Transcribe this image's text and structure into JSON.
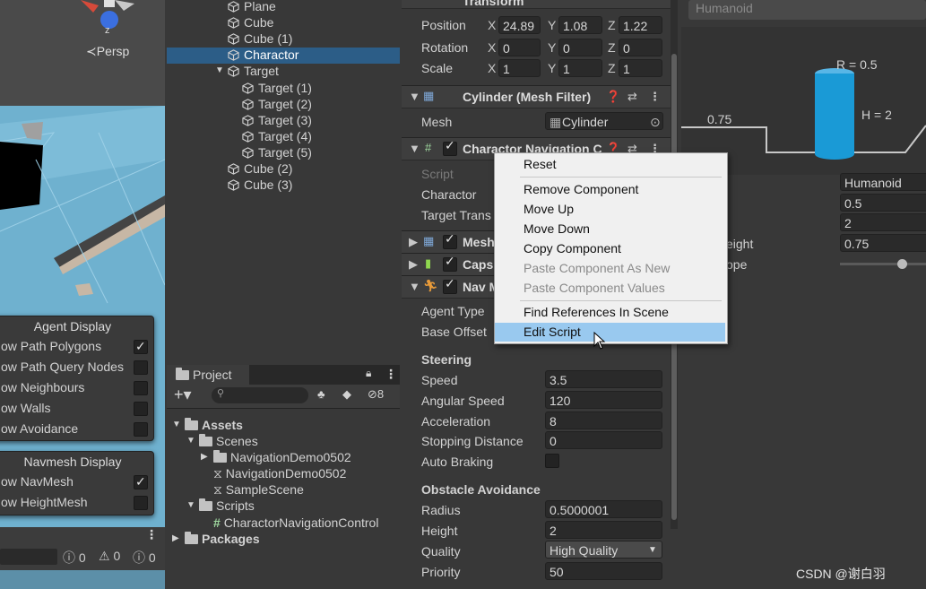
{
  "scene": {
    "axis_label": "z",
    "persp_label": "≺Persp",
    "agent_display": {
      "title": "Agent Display",
      "items": [
        {
          "label": "ow Path Polygons",
          "checked": true
        },
        {
          "label": "ow Path Query Nodes",
          "checked": false
        },
        {
          "label": "ow Neighbours",
          "checked": false
        },
        {
          "label": "ow Walls",
          "checked": false
        },
        {
          "label": "ow Avoidance",
          "checked": false
        }
      ]
    },
    "navmesh_display": {
      "title": "Navmesh Display",
      "items": [
        {
          "label": "ow NavMesh",
          "checked": true
        },
        {
          "label": "ow HeightMesh",
          "checked": false
        }
      ]
    },
    "status": {
      "info": "0",
      "warn": "0",
      "error": "0"
    }
  },
  "hierarchy": {
    "items": [
      {
        "label": "Plane",
        "depth": 1
      },
      {
        "label": "Cube",
        "depth": 1
      },
      {
        "label": "Cube (1)",
        "depth": 1
      },
      {
        "label": "Charactor",
        "depth": 1,
        "selected": true
      },
      {
        "label": "Target",
        "depth": 1,
        "expanded": true
      },
      {
        "label": "Target (1)",
        "depth": 2
      },
      {
        "label": "Target (2)",
        "depth": 2
      },
      {
        "label": "Target (3)",
        "depth": 2
      },
      {
        "label": "Target (4)",
        "depth": 2
      },
      {
        "label": "Target (5)",
        "depth": 2
      },
      {
        "label": "Cube (2)",
        "depth": 1
      },
      {
        "label": "Cube (3)",
        "depth": 1
      }
    ]
  },
  "project": {
    "tab_label": "Project",
    "hidden_count": "8",
    "tree": [
      {
        "label": "Assets",
        "kind": "folder",
        "bold": true,
        "depth": 0
      },
      {
        "label": "Scenes",
        "kind": "folder",
        "depth": 1
      },
      {
        "label": "NavigationDemo0502",
        "kind": "folder",
        "depth": 2
      },
      {
        "label": "NavigationDemo0502",
        "kind": "scene",
        "depth": 2
      },
      {
        "label": "SampleScene",
        "kind": "scene",
        "depth": 2
      },
      {
        "label": "Scripts",
        "kind": "folder",
        "depth": 1
      },
      {
        "label": "CharactorNavigationControl",
        "kind": "script",
        "depth": 2
      },
      {
        "label": "Packages",
        "kind": "folder",
        "bold": true,
        "depth": 0
      }
    ]
  },
  "inspector": {
    "transform": {
      "title": "Transform",
      "position_label": "Position",
      "rotation_label": "Rotation",
      "scale_label": "Scale",
      "position": {
        "x": "24.89",
        "y": "1.08",
        "z": "1.22"
      },
      "rotation": {
        "x": "0",
        "y": "0",
        "z": "0"
      },
      "scale": {
        "x": "1",
        "y": "1",
        "z": "1"
      },
      "axis_x": "X",
      "axis_y": "Y",
      "axis_z": "Z"
    },
    "mesh_filter": {
      "title": "Cylinder (Mesh Filter)",
      "mesh_label": "Mesh",
      "mesh_value": "Cylinder"
    },
    "char_nav": {
      "title": "Charactor Navigation C",
      "script_label": "Script",
      "charactor_label": "Charactor",
      "target_label": "Target Trans"
    },
    "mesh_renderer": {
      "title": "Mesh"
    },
    "capsule": {
      "title": "Caps"
    },
    "nav_agent": {
      "title": "Nav M",
      "agent_type_label": "Agent Type",
      "base_offset_label": "Base Offset",
      "steering_label": "Steering",
      "speed_label": "Speed",
      "speed": "3.5",
      "angular_speed_label": "Angular Speed",
      "angular_speed": "120",
      "acceleration_label": "Acceleration",
      "acceleration": "8",
      "stopping_distance_label": "Stopping Distance",
      "stopping_distance": "0",
      "auto_braking_label": "Auto Braking",
      "obstacle_label": "Obstacle Avoidance",
      "radius_label": "Radius",
      "radius": "0.5000001",
      "height_label": "Height",
      "height": "2",
      "quality_label": "Quality",
      "quality": "High Quality",
      "priority_label": "Priority",
      "priority": "50"
    }
  },
  "context_menu": {
    "items": [
      {
        "label": "Reset",
        "enabled": true
      },
      {
        "label": "Remove Component",
        "enabled": true
      },
      {
        "label": "Move Up",
        "enabled": true
      },
      {
        "label": "Move Down",
        "enabled": true
      },
      {
        "label": "Copy Component",
        "enabled": true
      },
      {
        "label": "Paste Component As New",
        "enabled": false
      },
      {
        "label": "Paste Component Values",
        "enabled": false
      },
      {
        "label": "Find References In Scene",
        "enabled": true
      },
      {
        "label": "Edit Script",
        "enabled": true,
        "highlighted": true
      }
    ]
  },
  "agent_settings": {
    "dropdown_value": "Humanoid",
    "diagram": {
      "radius_label": "R = 0.5",
      "height_label": "H = 2",
      "step_label": "0.75"
    },
    "name_value": "Humanoid",
    "radius_value": "0.5",
    "height_value": "2",
    "step_height_label": "eight",
    "step_height_value": "0.75",
    "max_slope_label": "ope"
  },
  "watermark": "CSDN @谢白羽",
  "colors": {
    "selection": "#2c5d87",
    "menu_highlight": "#99c9ef",
    "cylinder": "#1a9ad6"
  }
}
